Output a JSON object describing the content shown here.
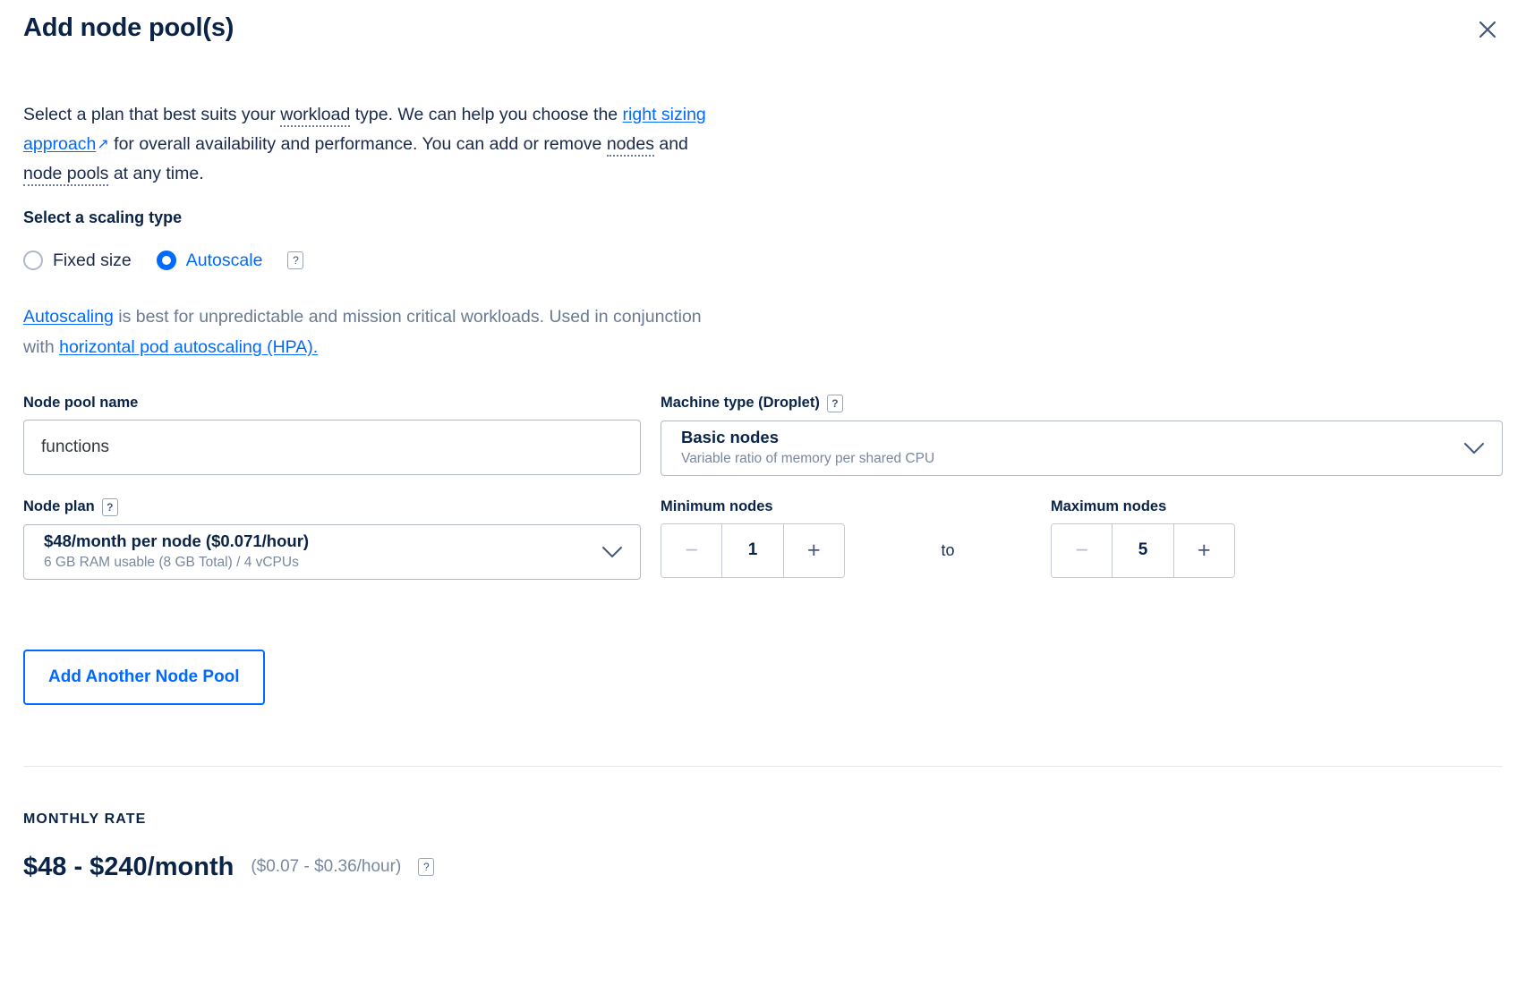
{
  "header": {
    "title": "Add node pool(s)",
    "close_icon": "close-icon"
  },
  "intro": {
    "part1": "Select a plan that best suits your ",
    "term_workload": "workload",
    "part2": " type. We can help you choose the ",
    "link_right_sizing": "right sizing approach",
    "external_arrow": "↗",
    "part3": " for overall availability and performance. You can add or remove ",
    "term_nodes": "nodes",
    "part4": " and ",
    "term_node_pools": "node pools",
    "part5": " at any time."
  },
  "scaling": {
    "label": "Select a scaling type",
    "options": [
      {
        "label": "Fixed size",
        "selected": false
      },
      {
        "label": "Autoscale",
        "selected": true
      }
    ],
    "help_badge": "?",
    "note_link_autoscaling": "Autoscaling",
    "note_part1": " is best for unpredictable and mission critical workloads. Used in conjunction with ",
    "note_link_hpa": "horizontal pod autoscaling (HPA)."
  },
  "form": {
    "node_pool_name": {
      "label": "Node pool name",
      "value": "functions",
      "placeholder": "Node pool name"
    },
    "machine_type": {
      "label": "Machine type (Droplet)",
      "help_badge": "?",
      "value": "Basic nodes",
      "description": "Variable ratio of memory per shared CPU",
      "chevron_icon": "chevron-down-icon"
    },
    "node_plan": {
      "label": "Node plan",
      "help_badge": "?",
      "value": "$48/month per node ($0.071/hour)",
      "description": "6 GB RAM usable (8 GB Total) / 4 vCPUs",
      "chevron_icon": "chevron-down-icon"
    },
    "minimum_nodes": {
      "label": "Minimum nodes",
      "value": "1",
      "decrement": "−",
      "increment": "+",
      "decrement_disabled": true
    },
    "between_text": "to",
    "maximum_nodes": {
      "label": "Maximum nodes",
      "value": "5",
      "decrement": "−",
      "increment": "+",
      "decrement_disabled": true
    }
  },
  "actions": {
    "add_another_node_pool": "Add Another Node Pool"
  },
  "footer": {
    "rate_label": "MONTHLY RATE",
    "rate_value": "$48 - $240/month",
    "rate_hourly": "($0.07 - $0.36/hour)",
    "help_badge": "?"
  },
  "colors": {
    "accent_blue": "#0069ff",
    "text_navy": "#0a2447",
    "muted_gray": "#7a889e",
    "border_gray": "#b3bac6"
  }
}
